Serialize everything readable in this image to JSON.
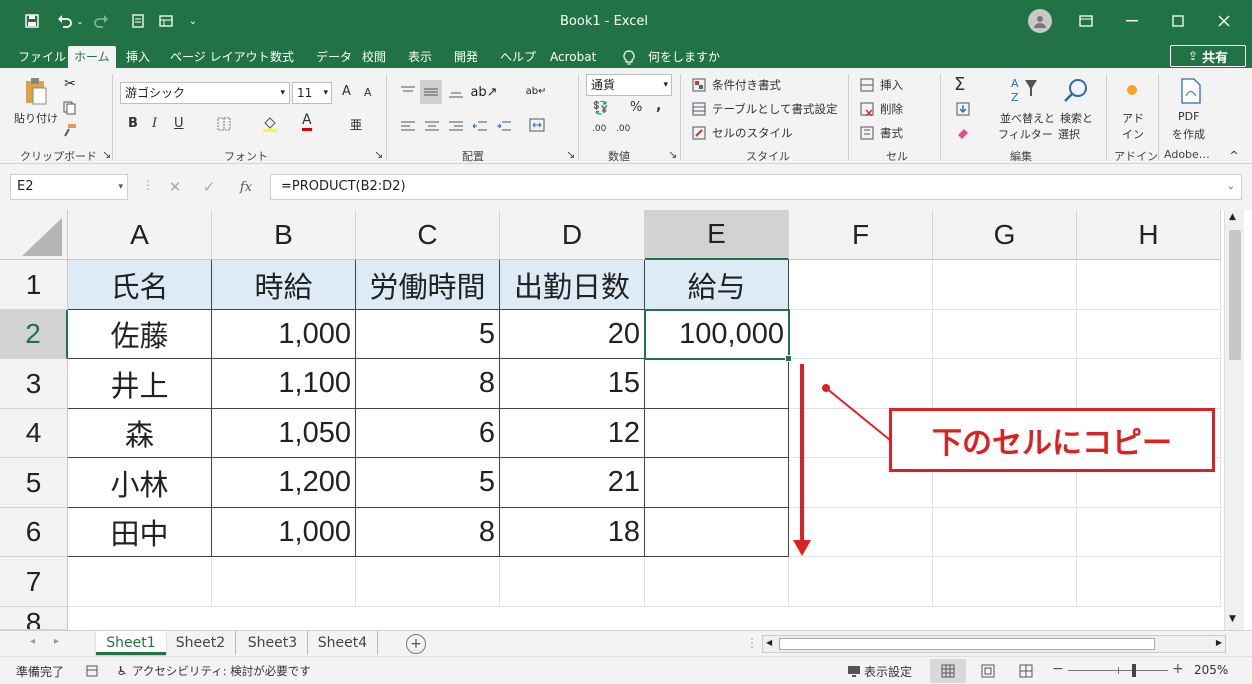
{
  "window": {
    "title": "Book1  -  Excel"
  },
  "ribbon_tabs": [
    "ファイル",
    "ホーム",
    "挿入",
    "ページ レイアウト",
    "数式",
    "データ",
    "校閲",
    "表示",
    "開発",
    "ヘルプ",
    "Acrobat"
  ],
  "search_label": "何をしますか",
  "share_label": "共有",
  "clipboard": {
    "paste_label": "貼り付け",
    "group": "クリップボード"
  },
  "font": {
    "name": "游ゴシック",
    "size": "11",
    "group": "フォント",
    "grow": "A",
    "shrink": "A",
    "bold": "B",
    "italic": "I",
    "underline": "U",
    "color_a": "A"
  },
  "alignment": {
    "group": "配置"
  },
  "number": {
    "format": "通貨",
    "percent": "%",
    "comma": ",",
    "inc": ".00",
    "group": "数値"
  },
  "styles": {
    "conditional": "条件付き書式",
    "table": "テーブルとして書式設定",
    "cell": "セルのスタイル",
    "group": "スタイル"
  },
  "cells_group": {
    "insert": "挿入",
    "delete": "削除",
    "format": "書式",
    "group": "セル"
  },
  "editing": {
    "sort_l1": "並べ替えと",
    "sort_l2": "フィルター",
    "find_l1": "検索と",
    "find_l2": "選択",
    "group": "編集",
    "sigma": "Σ"
  },
  "addin": {
    "l1": "アド",
    "l2": "イン",
    "group": "アドイン"
  },
  "pdf": {
    "l1": "PDF",
    "l2": "を作成",
    "group": "Adobe…"
  },
  "namebox": "E2",
  "fx": "fx",
  "formula": "=PRODUCT(B2:D2)",
  "columns": [
    "A",
    "B",
    "C",
    "D",
    "E",
    "F",
    "G",
    "H"
  ],
  "rows": [
    "1",
    "2",
    "3",
    "4",
    "5",
    "6",
    "7",
    "8"
  ],
  "table": {
    "headers": [
      "氏名",
      "時給",
      "労働時間",
      "出勤日数",
      "給与"
    ],
    "data": [
      [
        "佐藤",
        "1,000",
        "5",
        "20",
        "100,000"
      ],
      [
        "井上",
        "1,100",
        "8",
        "15",
        ""
      ],
      [
        "森",
        "1,050",
        "6",
        "12",
        ""
      ],
      [
        "小林",
        "1,200",
        "5",
        "21",
        ""
      ],
      [
        "田中",
        "1,000",
        "8",
        "18",
        ""
      ]
    ]
  },
  "annotation": {
    "text": "下のセルにコピー",
    "color": "#e02020"
  },
  "sheets": [
    "Sheet1",
    "Sheet2",
    "Sheet3",
    "Sheet4"
  ],
  "active_sheet": "Sheet1",
  "status": {
    "ready": "準備完了",
    "accessibility": "アクセシビリティ: 検討が必要です",
    "display_settings": "表示設定",
    "zoom": "205%"
  },
  "colors": {
    "excel_green": "#217346",
    "header_fill": "#ddebf7",
    "selected_header": "#d2d2d2"
  }
}
